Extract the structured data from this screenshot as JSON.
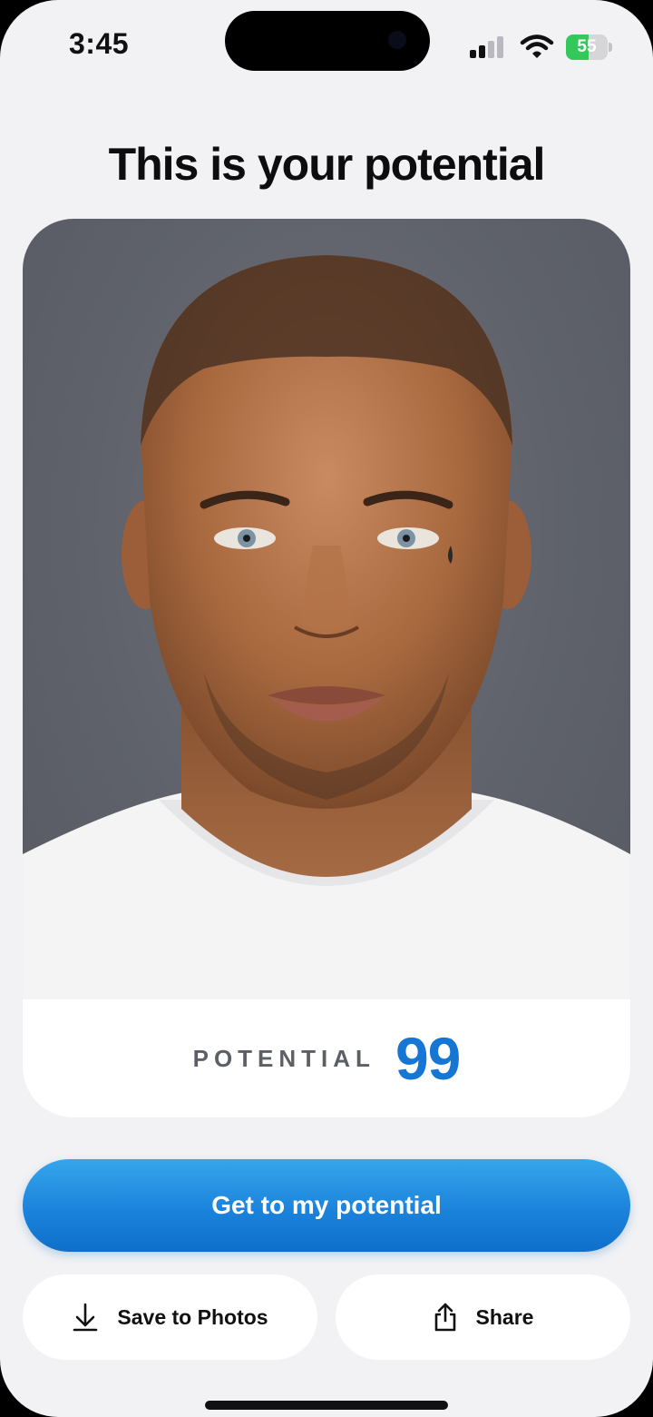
{
  "status_bar": {
    "time": "3:45",
    "battery_level": "55",
    "battery_fraction": 0.55,
    "icons": [
      "cellular-signal-icon",
      "wifi-icon",
      "battery-charging-icon"
    ]
  },
  "header": {
    "title": "This is your potential"
  },
  "result_card": {
    "photo_alt": "portrait photo",
    "score_label": "POTENTIAL",
    "score_value": "99"
  },
  "actions": {
    "primary_label": "Get to my potential",
    "save_label": "Save to Photos",
    "share_label": "Share"
  },
  "colors": {
    "accent": "#1576d4",
    "button_gradient_top": "#36a6ea",
    "button_gradient_bottom": "#0f6fcb",
    "battery_green": "#34c759"
  }
}
